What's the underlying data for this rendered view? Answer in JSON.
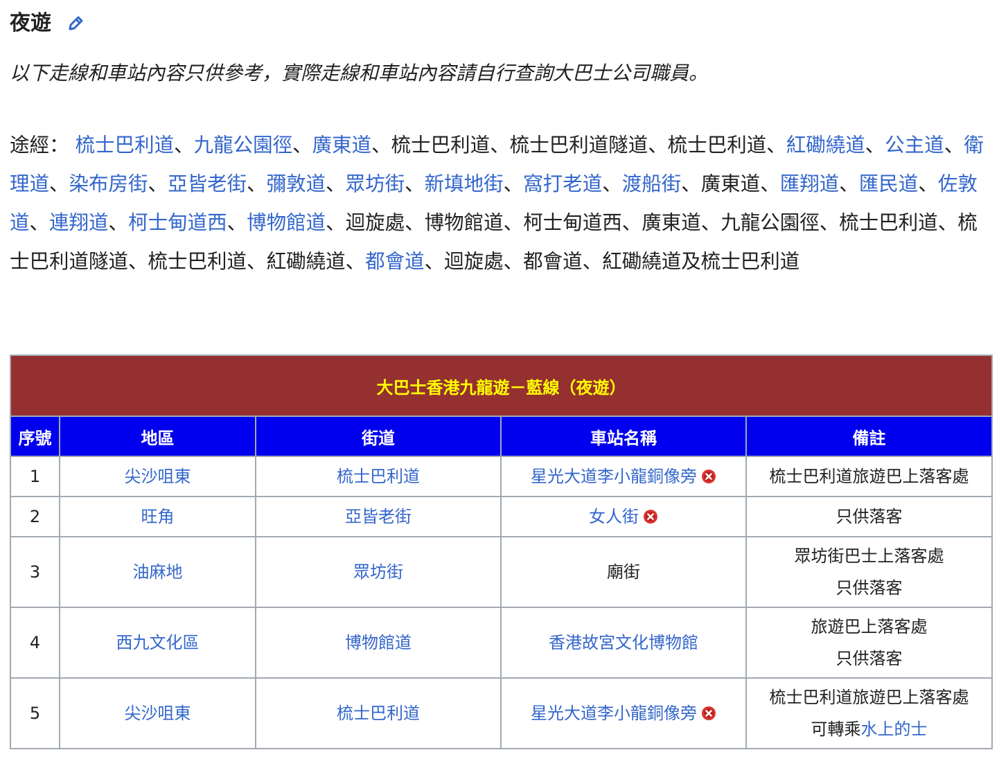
{
  "section": {
    "title": "夜遊",
    "edit_icon": "pencil-icon"
  },
  "notice": "以下走線和車站內容只供參考，實際走線和車站內容請自行查詢大巴士公司職員。",
  "route": {
    "prefix": "途經：",
    "segments": [
      {
        "text": "梳士巴利道",
        "link": true
      },
      {
        "text": "九龍公園徑",
        "link": true
      },
      {
        "text": "廣東道",
        "link": true
      },
      {
        "text": "梳士巴利道",
        "link": false
      },
      {
        "text": "梳士巴利道隧道",
        "link": false
      },
      {
        "text": "梳士巴利道",
        "link": false
      },
      {
        "text": "紅磡繞道",
        "link": true
      },
      {
        "text": "公主道",
        "link": true
      },
      {
        "text": "衛理道",
        "link": true
      },
      {
        "text": "染布房街",
        "link": true
      },
      {
        "text": "亞皆老街",
        "link": true
      },
      {
        "text": "彌敦道",
        "link": true
      },
      {
        "text": "眾坊街",
        "link": true
      },
      {
        "text": "新填地街",
        "link": true
      },
      {
        "text": "窩打老道",
        "link": true
      },
      {
        "text": "渡船街",
        "link": true
      },
      {
        "text": "廣東道",
        "link": false
      },
      {
        "text": "匯翔道",
        "link": true
      },
      {
        "text": "匯民道",
        "link": true
      },
      {
        "text": "佐敦道",
        "link": true
      },
      {
        "text": "連翔道",
        "link": true
      },
      {
        "text": "柯士甸道西",
        "link": true
      },
      {
        "text": "博物館道",
        "link": true
      },
      {
        "text": "迴旋處",
        "link": false
      },
      {
        "text": "博物館道",
        "link": false
      },
      {
        "text": "柯士甸道西",
        "link": false
      },
      {
        "text": "廣東道",
        "link": false
      },
      {
        "text": "九龍公園徑",
        "link": false
      },
      {
        "text": "梳士巴利道",
        "link": false
      },
      {
        "text": "梳士巴利道隧道",
        "link": false
      },
      {
        "text": "梳士巴利道",
        "link": false
      },
      {
        "text": "紅磡繞道",
        "link": false
      },
      {
        "text": "都會道",
        "link": true
      },
      {
        "text": "迴旋處",
        "link": false
      },
      {
        "text": "都會道",
        "link": false
      },
      {
        "text": "紅磡繞道及梳士巴利道",
        "link": false
      }
    ],
    "separator": "、"
  },
  "table": {
    "title": "大巴士香港九龍遊－藍線（夜遊）",
    "title_bg": "#953030",
    "title_color": "#ffff00",
    "header_bg": "#0000ee",
    "headers": [
      "序號",
      "地區",
      "街道",
      "車站名稱",
      "備註"
    ],
    "rows": [
      {
        "no": "1",
        "district": "尖沙咀東",
        "street": "梳士巴利道",
        "stop": "星光大道李小龍銅像旁",
        "stop_link": true,
        "stop_closed": true,
        "remarks": [
          "梳士巴利道旅遊巴上落客處"
        ],
        "remarks_link": []
      },
      {
        "no": "2",
        "district": "旺角",
        "street": "亞皆老街",
        "stop": "女人街",
        "stop_link": true,
        "stop_closed": true,
        "remarks": [
          "只供落客"
        ],
        "remarks_link": []
      },
      {
        "no": "3",
        "district": "油麻地",
        "street": "眾坊街",
        "stop": "廟街",
        "stop_link": false,
        "stop_closed": false,
        "remarks": [
          "眾坊街巴士上落客處",
          "只供落客"
        ],
        "remarks_link": []
      },
      {
        "no": "4",
        "district": "西九文化區",
        "street": "博物館道",
        "stop": "香港故宮文化博物館",
        "stop_link": true,
        "stop_closed": false,
        "remarks": [
          "旅遊巴上落客處",
          "只供落客"
        ],
        "remarks_link": []
      },
      {
        "no": "5",
        "district": "尖沙咀東",
        "street": "梳士巴利道",
        "stop": "星光大道李小龍銅像旁",
        "stop_link": true,
        "stop_closed": true,
        "remarks": [
          "梳士巴利道旅遊巴上落客處",
          "可轉乘"
        ],
        "remarks_link": [
          "水上的士"
        ]
      }
    ],
    "closed_icon": "closed-x-icon"
  }
}
